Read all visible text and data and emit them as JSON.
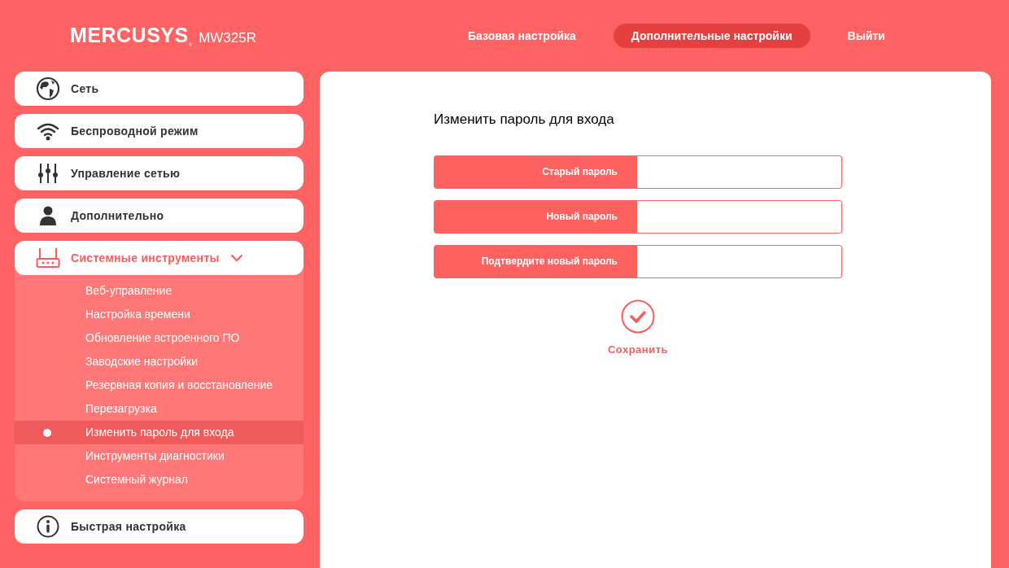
{
  "header": {
    "logo": "MERCUSYS",
    "logo_mark": "®",
    "model": "MW325R"
  },
  "nav": [
    {
      "label": "Базовая настройка",
      "selected": false
    },
    {
      "label": "Дополнительные настройки",
      "selected": true
    },
    {
      "label": "Выйти",
      "selected": false
    }
  ],
  "sidebar": {
    "items": [
      {
        "label": "Сеть",
        "kind": "globe",
        "expanded": false
      },
      {
        "label": "Беспроводной режим",
        "kind": "wifi",
        "expanded": false
      },
      {
        "label": "Управление сетью",
        "kind": "sliders",
        "expanded": false
      },
      {
        "label": "Дополнительно",
        "kind": "user",
        "expanded": false
      },
      {
        "label": "Системные инструменты",
        "kind": "router",
        "expanded": true,
        "children": [
          {
            "label": "Веб-управление",
            "selected": false
          },
          {
            "label": "Настройка времени",
            "selected": false
          },
          {
            "label": "Обновление встроенного ПО",
            "selected": false
          },
          {
            "label": "Заводские настройки",
            "selected": false
          },
          {
            "label": "Резервная копия и восстановление",
            "selected": false
          },
          {
            "label": "Перезагрузка",
            "selected": false
          },
          {
            "label": "Изменить пароль для входа",
            "selected": true
          },
          {
            "label": "Инструменты диагностики",
            "selected": false
          },
          {
            "label": "Системный журнал",
            "selected": false
          }
        ]
      },
      {
        "label": "Быстрая настройка",
        "kind": "info",
        "expanded": false
      }
    ]
  },
  "form": {
    "title": "Изменить пароль для входа",
    "fields": [
      {
        "label": "Старый пароль"
      },
      {
        "label": "Новый пароль"
      },
      {
        "label": "Подтвердите новый пароль"
      }
    ],
    "save": "Сохранить"
  }
}
